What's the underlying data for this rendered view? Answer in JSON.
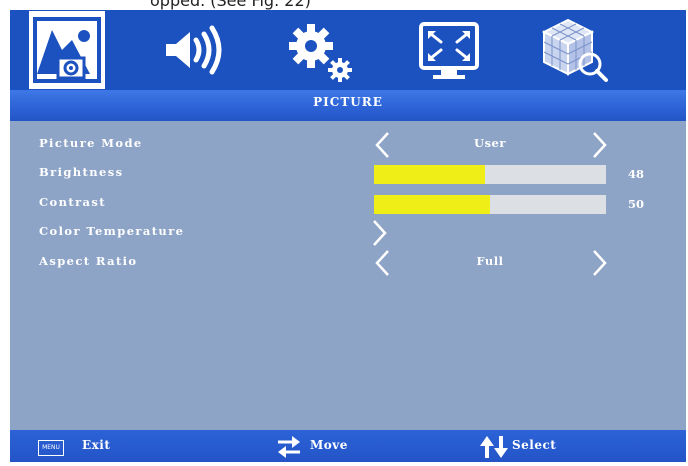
{
  "top_caption": "opped. (See Fig. 22)",
  "tabs": [
    {
      "icon": "picture-icon",
      "active": true
    },
    {
      "icon": "sound-icon",
      "active": false
    },
    {
      "icon": "settings-icon",
      "active": false
    },
    {
      "icon": "screen-icon",
      "active": false
    },
    {
      "icon": "cube-icon",
      "active": false
    }
  ],
  "menu": {
    "title": "PICTURE",
    "items": [
      {
        "label": "Picture Mode",
        "value": "User"
      },
      {
        "label": "Brightness",
        "value": "48"
      },
      {
        "label": "Contrast",
        "value": "50"
      },
      {
        "label": "Color Temperature"
      },
      {
        "label": "Aspect Ratio",
        "value": "Full"
      }
    ]
  },
  "footer": {
    "exit_key": "MENU",
    "exit_label": "Exit",
    "move_label": "Move",
    "select_label": "Select"
  },
  "colors": {
    "accent": "#1c52bf",
    "panel": "#8ea4c6",
    "bar_fill": "#f0ee17",
    "bar_track": "#dcdfe4"
  }
}
